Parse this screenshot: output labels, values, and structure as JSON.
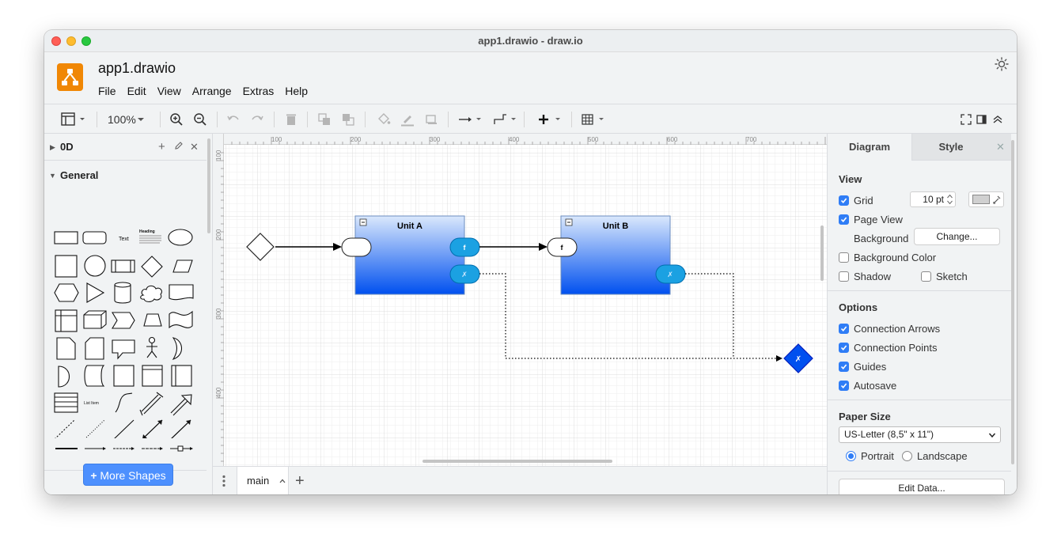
{
  "window": {
    "title": "app1.drawio - draw.io"
  },
  "app": {
    "doc_title": "app1.drawio"
  },
  "menu": [
    "File",
    "Edit",
    "View",
    "Arrange",
    "Extras",
    "Help"
  ],
  "toolbar": {
    "zoom": "100%"
  },
  "sidebar": {
    "section_0d": "0D",
    "section_general": "General",
    "shape_text": "Text",
    "shape_heading": "Heading",
    "shape_listitem": "List Item",
    "more_shapes": "More Shapes"
  },
  "ruler": {
    "x_ticks": [
      "100",
      "200",
      "300",
      "400",
      "500",
      "600",
      "700"
    ],
    "y_ticks": [
      "100",
      "200",
      "300",
      "400"
    ]
  },
  "diagram": {
    "unit_a": "Unit A",
    "unit_b": "Unit B",
    "port_f": "f",
    "port_x": "✗",
    "collapse": "−"
  },
  "pages": {
    "current": "main"
  },
  "format_panel": {
    "tab_diagram": "Diagram",
    "tab_style": "Style",
    "view_title": "View",
    "grid_label": "Grid",
    "grid_size": "10 pt",
    "page_view_label": "Page View",
    "background_label": "Background",
    "change_button": "Change...",
    "background_color_label": "Background Color",
    "shadow_label": "Shadow",
    "sketch_label": "Sketch",
    "options_title": "Options",
    "connection_arrows": "Connection Arrows",
    "connection_points": "Connection Points",
    "guides": "Guides",
    "autosave": "Autosave",
    "paper_size_title": "Paper Size",
    "paper_size_value": "US-Letter (8,5\" x 11\")",
    "portrait": "Portrait",
    "landscape": "Landscape",
    "edit_data": "Edit Data..."
  },
  "colors": {
    "accent": "#2f7df6",
    "logo": "#f08705",
    "port": "#1ba1e2",
    "container_top": "#dae8fc",
    "container_bottom": "#0050ef"
  }
}
